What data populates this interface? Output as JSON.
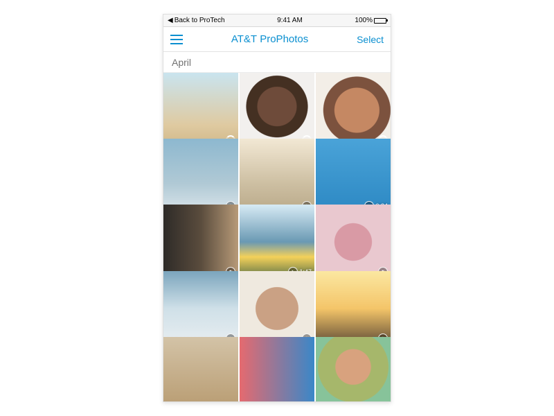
{
  "status": {
    "back": "Back to ProTech",
    "time": "9:41 AM",
    "battery_pct": "100%"
  },
  "nav": {
    "title_strong": "AT&T",
    "title_light": "ProPhotos",
    "select": "Select"
  },
  "section": {
    "label": "April"
  },
  "grid": {
    "items": [
      {
        "badge": "spinner"
      },
      {
        "badge": "spinner"
      },
      {
        "badge": "spinner"
      },
      {
        "badge": "cloud"
      },
      {
        "badge": "cloud"
      },
      {
        "badge": "video",
        "duration": "0:34"
      },
      {
        "badge": "cloud"
      },
      {
        "badge": "video",
        "duration": "1:47"
      },
      {
        "badge": "cloud"
      },
      {
        "badge": "cloud"
      },
      {
        "badge": "cloud"
      },
      {
        "badge": "cloud"
      },
      {
        "badge": null
      },
      {
        "badge": null
      },
      {
        "badge": null
      }
    ]
  }
}
